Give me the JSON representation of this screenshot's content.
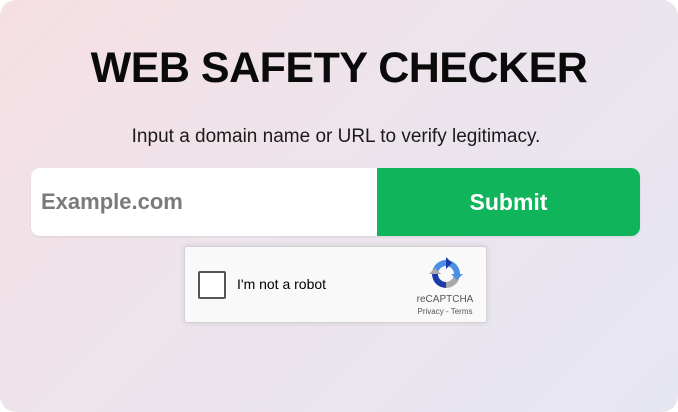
{
  "page": {
    "title": "WEB SAFETY CHECKER",
    "subtitle": "Input a domain name or URL to verify legitimacy."
  },
  "form": {
    "input_placeholder": "Example.com",
    "input_value": "",
    "submit_label": "Submit"
  },
  "captcha": {
    "label": "I'm not a robot",
    "checked": false,
    "brand": "reCAPTCHA",
    "privacy_label": "Privacy",
    "separator": " - ",
    "terms_label": "Terms",
    "logo_icon": "recaptcha-logo-icon"
  },
  "colors": {
    "submit_bg": "#10b45a",
    "text": "#0a0a0a",
    "bg_gradient_start": "#f6dfe3",
    "bg_gradient_end": "#e6e6f2"
  }
}
